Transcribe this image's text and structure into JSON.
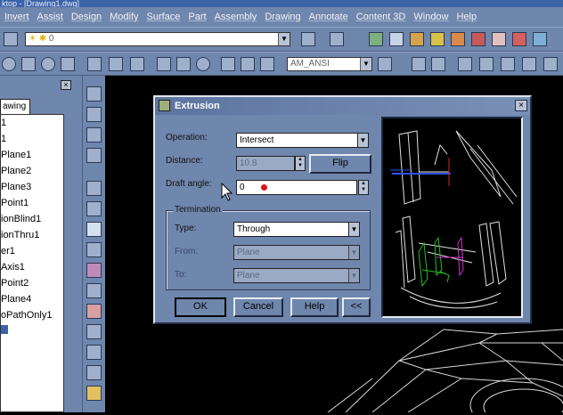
{
  "app": {
    "title": "ktop - [Drawing1.dwg]"
  },
  "menu": [
    "Invert",
    "Assist",
    "Design",
    "Modify",
    "Surface",
    "Part",
    "Assembly",
    "Drawing",
    "Annotate",
    "Content 3D",
    "Window",
    "Help"
  ],
  "toolbar": {
    "layer_value": "0",
    "textstyle_value": "AM_ANSI"
  },
  "browser": {
    "tab_label": "awing",
    "items": [
      "1",
      "1",
      "Plane1",
      "Plane2",
      "Plane3",
      "Point1",
      "ionBlind1",
      "ionThru1",
      "er1",
      "Axis1",
      "Point2",
      "Plane4",
      "oPathOnly1"
    ]
  },
  "dialog": {
    "title": "Extrusion",
    "close_label": "×",
    "operation_label": "Operation:",
    "operation_value": "Intersect",
    "distance_label": "Distance:",
    "distance_value": "10.8",
    "flip_label": "Flip",
    "draft_label": "Draft angle:",
    "draft_value": "0",
    "termination_label": "Termination",
    "type_label": "Type:",
    "type_value": "Through",
    "from_label": "From:",
    "from_value": "Plane",
    "to_label": "To:",
    "to_value": "Plane",
    "ok_label": "OK",
    "cancel_label": "Cancel",
    "help_label": "Help",
    "collapse_label": "<<"
  },
  "colors": {
    "panel": "#6f86ad",
    "titlebar": "#3c63a8",
    "cursor_dot": "#e01010"
  }
}
